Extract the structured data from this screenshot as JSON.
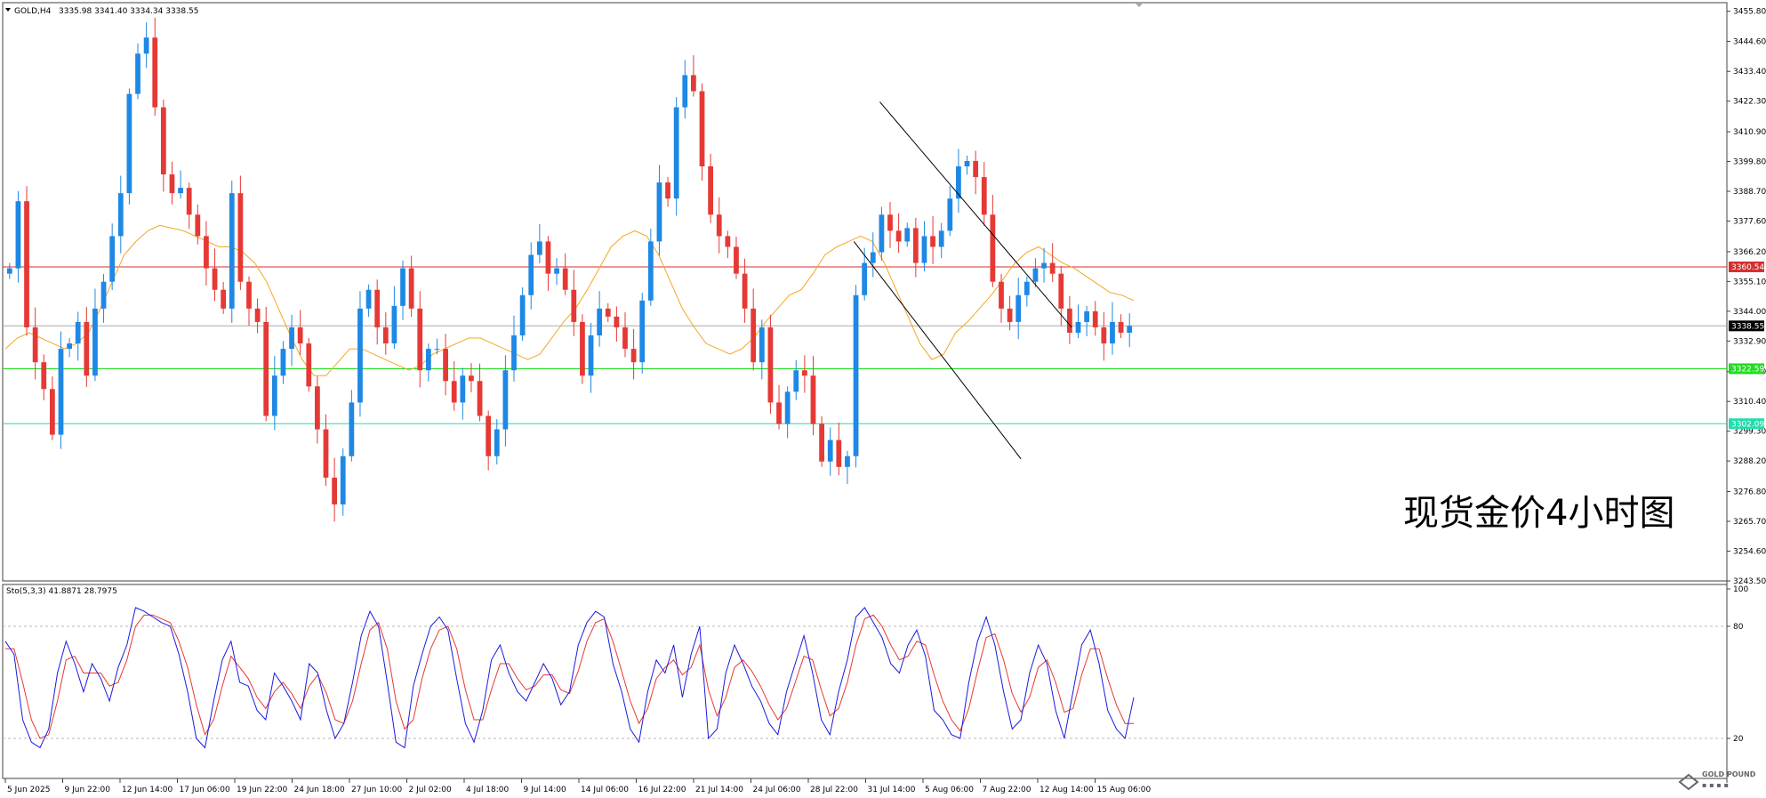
{
  "header": {
    "symbol": "GOLD,H4",
    "ohlc": "3335.98 3341.40 3334.34 3338.55"
  },
  "watermark": "现货金价4小时图",
  "brand": "GOLD POUND",
  "colors": {
    "bull": "#1e88e5",
    "bear": "#e53935",
    "ma": "#f5a623",
    "resistance": "#d32f2f",
    "support1": "#22dd22",
    "support2": "#22ddaa",
    "current": "#aaaaaa",
    "stoch_k": "#1a1adf",
    "stoch_d": "#e53935",
    "channel": "#000000",
    "frame": "#404040"
  },
  "chart_data": [
    {
      "type": "candlestick",
      "title": "GOLD,H4",
      "y_ticks": [
        "3455.80",
        "3444.60",
        "3433.40",
        "3422.30",
        "3410.90",
        "3399.80",
        "3388.70",
        "3377.60",
        "3366.20",
        "3355.10",
        "3344.00",
        "3332.90",
        "3321.50",
        "3310.40",
        "3299.30",
        "3288.20",
        "3276.80",
        "3265.70",
        "3254.60",
        "3243.50"
      ],
      "ylim": [
        3243.5,
        3459.0
      ],
      "x_ticks": [
        "5 Jun 2025",
        "9 Jun 22:00",
        "12 Jun 14:00",
        "17 Jun 06:00",
        "19 Jun 22:00",
        "24 Jun 18:00",
        "27 Jun 10:00",
        "2 Jul 02:00",
        "4 Jul 18:00",
        "9 Jul 14:00",
        "14 Jul 06:00",
        "16 Jul 22:00",
        "21 Jul 14:00",
        "24 Jul 06:00",
        "28 Jul 22:00",
        "31 Jul 14:00",
        "5 Aug 06:00",
        "7 Aug 22:00",
        "12 Aug 14:00",
        "15 Aug 06:00"
      ],
      "levels": [
        {
          "label": "3360.54",
          "value": 3360.54,
          "kind": "resistance"
        },
        {
          "label": "3322.59",
          "value": 3322.59,
          "kind": "support1"
        },
        {
          "label": "3302.09",
          "value": 3302.09,
          "kind": "support2"
        },
        {
          "label": "3338.55",
          "value": 3338.55,
          "kind": "current"
        }
      ],
      "close_path": [
        3360,
        3385,
        3338,
        3325,
        3315,
        3298,
        3330,
        3332,
        3340,
        3320,
        3345,
        3355,
        3372,
        3388,
        3425,
        3440,
        3446,
        3420,
        3395,
        3388,
        3390,
        3380,
        3372,
        3360,
        3352,
        3345,
        3388,
        3355,
        3345,
        3340,
        3305,
        3320,
        3330,
        3338,
        3332,
        3316,
        3300,
        3282,
        3272,
        3290,
        3310,
        3345,
        3352,
        3338,
        3332,
        3346,
        3360,
        3345,
        3322,
        3330,
        3330,
        3318,
        3310,
        3320,
        3318,
        3305,
        3290,
        3300,
        3322,
        3335,
        3350,
        3365,
        3370,
        3358,
        3360,
        3352,
        3340,
        3320,
        3335,
        3345,
        3342,
        3338,
        3330,
        3325,
        3348,
        3370,
        3392,
        3386,
        3420,
        3432,
        3426,
        3398,
        3380,
        3372,
        3368,
        3358,
        3345,
        3325,
        3338,
        3310,
        3302,
        3314,
        3322,
        3320,
        3302,
        3288,
        3296,
        3286,
        3290,
        3350,
        3362,
        3366,
        3380,
        3374,
        3370,
        3375,
        3362,
        3372,
        3368,
        3374,
        3386,
        3398,
        3400,
        3394,
        3380,
        3355,
        3345,
        3340,
        3350,
        3355,
        3360,
        3362,
        3358,
        3345,
        3336,
        3340,
        3344,
        3338,
        3332,
        3340,
        3336,
        3338.55
      ],
      "ma_path": [
        3330,
        3334,
        3336,
        3334,
        3332,
        3330,
        3332,
        3336,
        3345,
        3355,
        3365,
        3370,
        3374,
        3376,
        3375,
        3374,
        3372,
        3370,
        3368,
        3368,
        3366,
        3362,
        3355,
        3345,
        3335,
        3326,
        3320,
        3320,
        3325,
        3330,
        3330,
        3328,
        3326,
        3324,
        3322,
        3324,
        3328,
        3330,
        3332,
        3334,
        3334,
        3332,
        3330,
        3328,
        3326,
        3328,
        3334,
        3340,
        3345,
        3352,
        3360,
        3368,
        3372,
        3374,
        3372,
        3365,
        3355,
        3345,
        3338,
        3332,
        3330,
        3328,
        3330,
        3334,
        3340,
        3345,
        3350,
        3352,
        3358,
        3365,
        3368,
        3370,
        3372,
        3370,
        3362,
        3352,
        3342,
        3332,
        3326,
        3328,
        3336,
        3340,
        3345,
        3350,
        3356,
        3362,
        3366,
        3368,
        3365,
        3362,
        3360,
        3357,
        3354,
        3351,
        3350,
        3348
      ],
      "channel": [
        {
          "from": [
            0.775,
            3422
          ],
          "to": [
            0.945,
            3338
          ]
        },
        {
          "from": [
            0.752,
            3370
          ],
          "to": [
            0.9,
            3289
          ]
        }
      ]
    },
    {
      "type": "line",
      "title": "Sto(5,3,3) 41.8871 28.7975",
      "ylim": [
        0,
        100
      ],
      "y_ticks": [
        "100",
        "80",
        "20"
      ],
      "levels": [
        80,
        20
      ],
      "series": [
        {
          "name": "K",
          "values": [
            72,
            65,
            30,
            18,
            15,
            25,
            55,
            72,
            60,
            45,
            60,
            52,
            40,
            58,
            70,
            90,
            88,
            85,
            82,
            80,
            65,
            45,
            20,
            15,
            40,
            62,
            72,
            50,
            48,
            35,
            30,
            55,
            48,
            40,
            30,
            60,
            55,
            35,
            20,
            28,
            50,
            75,
            88,
            80,
            50,
            18,
            15,
            48,
            65,
            80,
            85,
            78,
            52,
            28,
            18,
            35,
            62,
            70,
            55,
            45,
            40,
            50,
            60,
            52,
            38,
            45,
            70,
            82,
            88,
            85,
            60,
            45,
            25,
            18,
            45,
            62,
            55,
            70,
            42,
            65,
            80,
            20,
            25,
            55,
            70,
            60,
            48,
            40,
            28,
            22,
            45,
            60,
            75,
            55,
            30,
            22,
            45,
            62,
            85,
            90,
            82,
            74,
            60,
            55,
            70,
            78,
            64,
            35,
            30,
            22,
            20,
            50,
            72,
            85,
            70,
            45,
            25,
            30,
            55,
            70,
            60,
            35,
            20,
            45,
            70,
            78,
            60,
            35,
            25,
            20,
            42
          ],
          "d": [
            68,
            68,
            50,
            30,
            20,
            22,
            40,
            62,
            64,
            55,
            55,
            55,
            48,
            50,
            62,
            80,
            86,
            86,
            84,
            82,
            72,
            58,
            38,
            22,
            30,
            48,
            64,
            58,
            52,
            42,
            36,
            45,
            50,
            44,
            36,
            48,
            54,
            44,
            30,
            28,
            40,
            60,
            78,
            82,
            68,
            40,
            25,
            30,
            52,
            68,
            78,
            80,
            68,
            46,
            30,
            30,
            46,
            60,
            60,
            52,
            46,
            48,
            54,
            54,
            46,
            44,
            56,
            72,
            82,
            84,
            72,
            56,
            40,
            28,
            36,
            52,
            58,
            62,
            54,
            58,
            70,
            46,
            32,
            42,
            58,
            62,
            56,
            48,
            38,
            30,
            36,
            50,
            64,
            62,
            46,
            32,
            36,
            50,
            70,
            84,
            86,
            80,
            70,
            62,
            64,
            72,
            70,
            54,
            40,
            30,
            24,
            36,
            56,
            74,
            76,
            62,
            44,
            34,
            42,
            58,
            62,
            50,
            34,
            36,
            54,
            68,
            68,
            52,
            38,
            28,
            28
          ]
        }
      ]
    }
  ]
}
